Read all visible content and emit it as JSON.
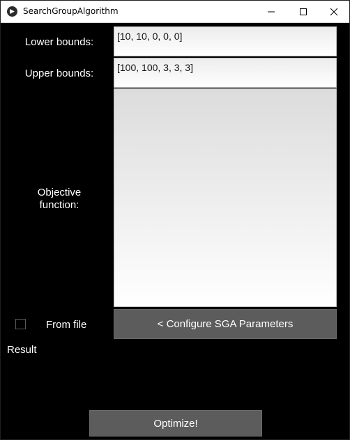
{
  "window": {
    "title": "SearchGroupAlgorithm",
    "icon": "kivy-app-icon"
  },
  "form": {
    "lower_label": "Lower bounds:",
    "lower_value": "[10, 10, 0, 0, 0]",
    "upper_label": "Upper bounds:",
    "upper_value": "[100, 100, 3, 3, 3]",
    "objective_label_line1": "Objective",
    "objective_label_line2": "function:",
    "objective_value": "",
    "from_file_label": "From file",
    "from_file_checked": false,
    "configure_button": "< Configure SGA Parameters"
  },
  "result": {
    "label": "Result"
  },
  "actions": {
    "optimize_button": "Optimize!"
  },
  "colors": {
    "background": "#000000",
    "button": "#5c5c5c",
    "text": "#ffffff"
  }
}
